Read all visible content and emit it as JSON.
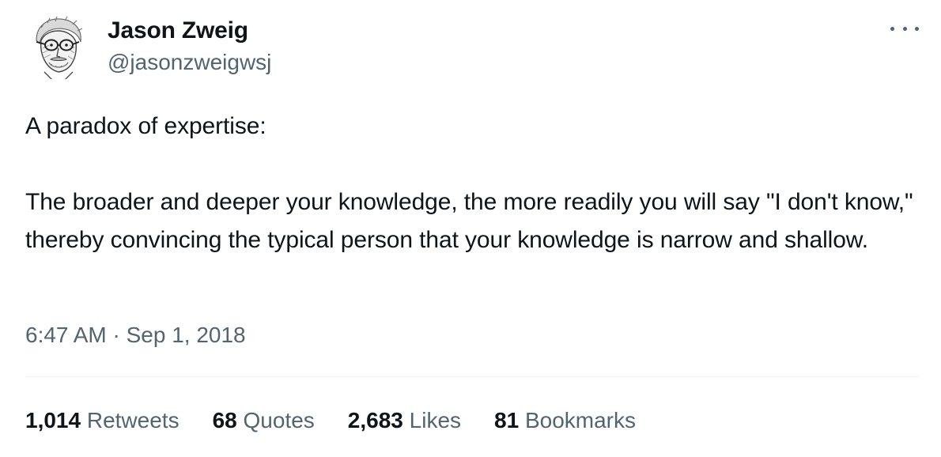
{
  "author": {
    "display_name": "Jason Zweig",
    "handle": "@jasonzweigwsj"
  },
  "tweet": {
    "paragraphs": [
      "A paradox of expertise:",
      "The broader and deeper your knowledge, the more readily you will say \"I don't know,\" thereby convincing the typical person that your knowledge is narrow and shallow."
    ],
    "timestamp": "6:47 AM · Sep 1, 2018"
  },
  "stats": [
    {
      "count": "1,014",
      "label": "Retweets"
    },
    {
      "count": "68",
      "label": "Quotes"
    },
    {
      "count": "2,683",
      "label": "Likes"
    },
    {
      "count": "81",
      "label": "Bookmarks"
    }
  ],
  "icons": {
    "more": "more-horizontal-icon"
  },
  "colors": {
    "text_primary": "#0f1419",
    "text_secondary": "#536471",
    "divider": "#eff3f4",
    "background": "#ffffff"
  }
}
